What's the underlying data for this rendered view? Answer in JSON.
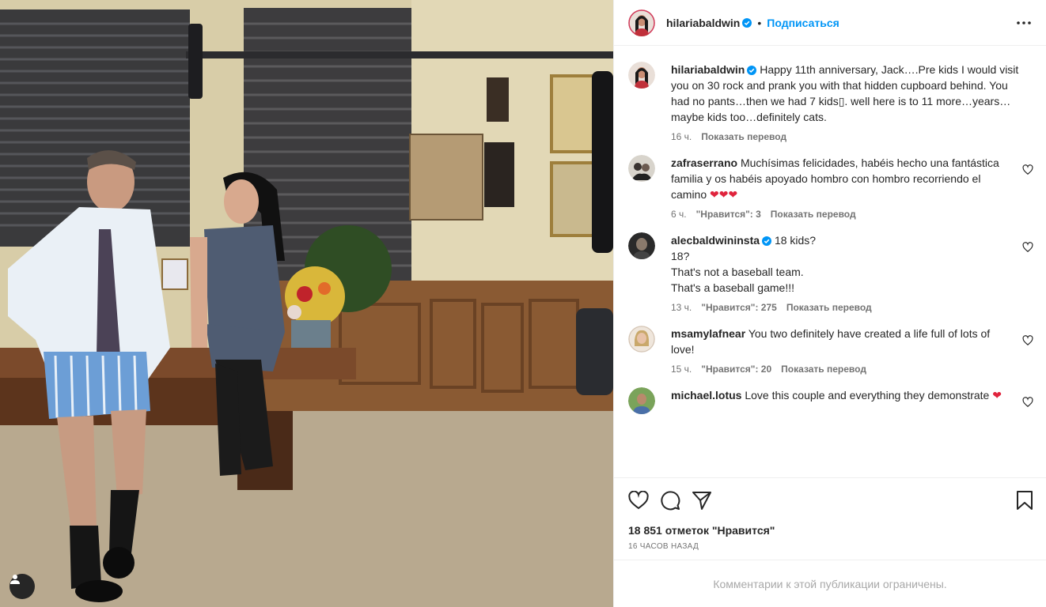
{
  "photo": {
    "alt": "Фото публикации"
  },
  "author": {
    "username": "hilariabaldwin",
    "follow_label": "Подписаться",
    "dot": "•"
  },
  "caption": {
    "username": "hilariabaldwin",
    "text": "Happy 11th anniversary, Jack….Pre kids I would visit you on 30 rock and prank you with that hidden cupboard behind. You had no pants…then we had 7 kids▯. well here is to 11 more…years…maybe kids too…definitely cats.",
    "time": "16 ч.",
    "translate": "Показать перевод"
  },
  "comments": [
    {
      "username": "zafraserrano",
      "verified": false,
      "text": "Muchísimas felicidades, habéis hecho una fantástica familia y os habéis apoyado hombro con hombro recorriendo el camino",
      "emoji": "❤❤❤",
      "time": "6 ч.",
      "likes": "\"Нравится\": 3",
      "translate": "Показать перевод"
    },
    {
      "username": "alecbaldwininsta",
      "verified": true,
      "text": "18 kids?",
      "lines": [
        "18?",
        "That's not a baseball team.",
        "That's a baseball game!!!"
      ],
      "time": "13 ч.",
      "likes": "\"Нравится\": 275",
      "translate": "Показать перевод"
    },
    {
      "username": "msamylafnear",
      "verified": false,
      "text": "You two definitely have created a life full of lots of love!",
      "time": "15 ч.",
      "likes": "\"Нравится\": 20",
      "translate": "Показать перевод"
    },
    {
      "username": "michael.lotus",
      "verified": false,
      "text": "Love this couple and everything they demonstrate",
      "emoji": "❤"
    }
  ],
  "stats": {
    "likes": "18 851 отметок \"Нравится\"",
    "time": "16 ЧАСОВ НАЗАД"
  },
  "footer": {
    "restricted": "Комментарии к этой публикации ограничены."
  },
  "colors": {
    "accent": "#0095f6",
    "verified": "#0095f6",
    "heart": "#e0243d",
    "muted": "#737373"
  }
}
